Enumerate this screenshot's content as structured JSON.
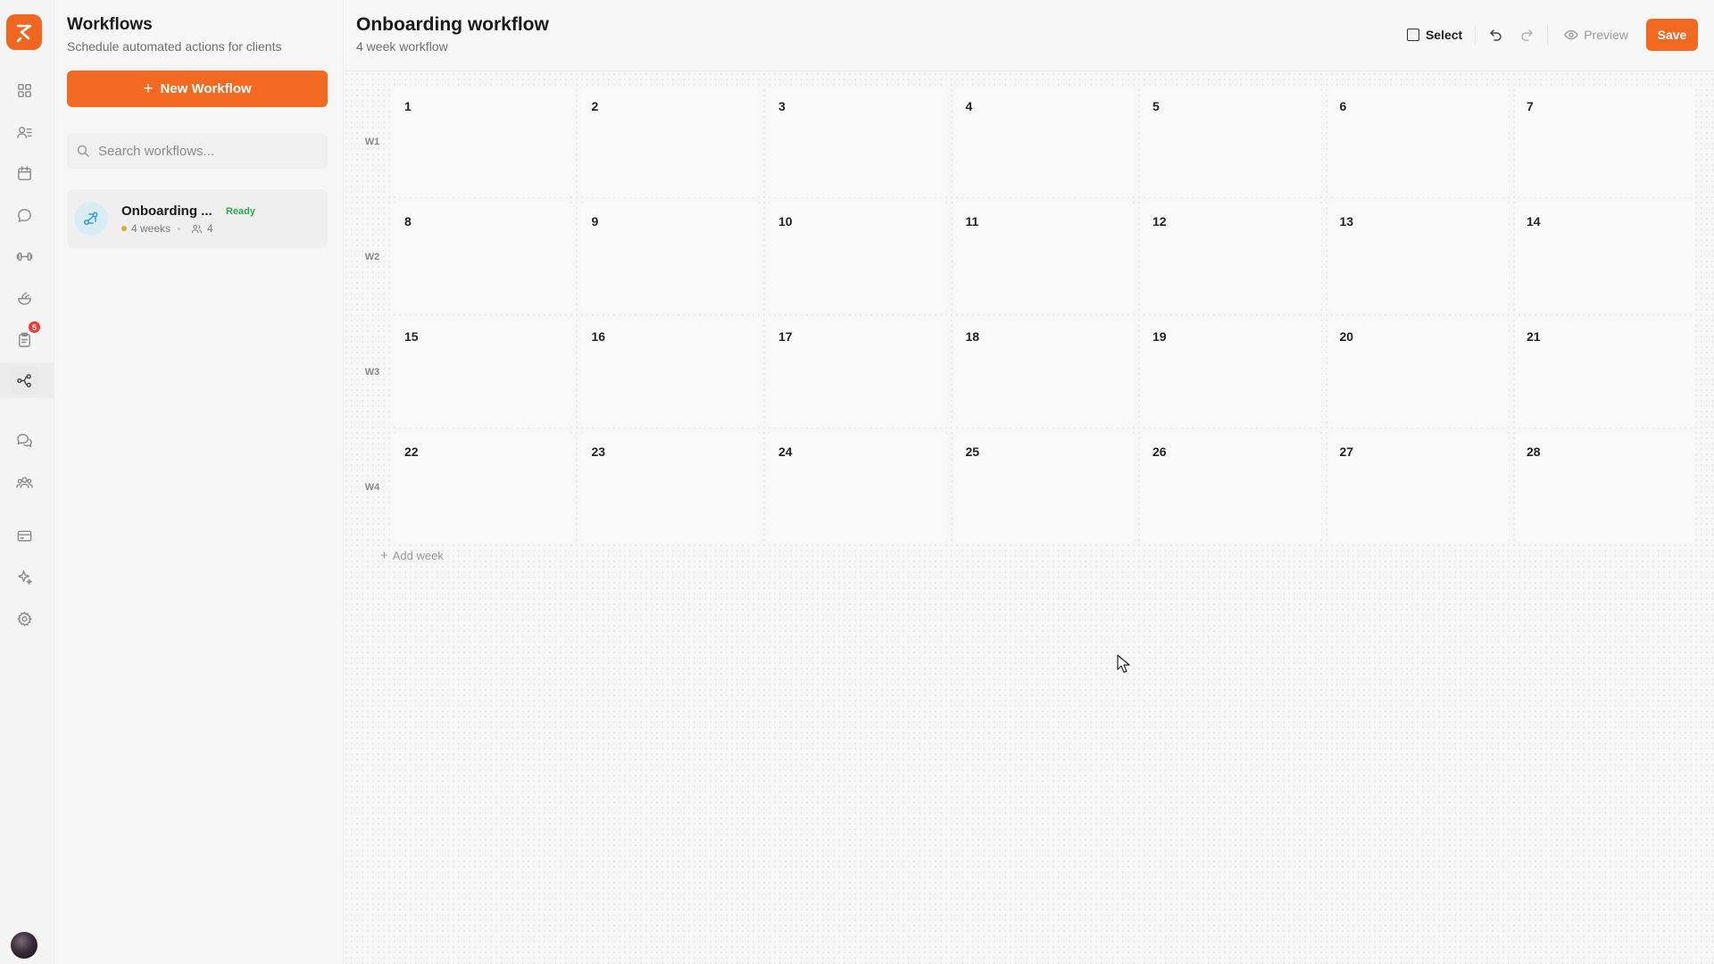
{
  "rail": {
    "items": [
      {
        "name": "dashboard",
        "icon": "grid-icon"
      },
      {
        "name": "clients",
        "icon": "users-list-icon"
      },
      {
        "name": "calendar",
        "icon": "calendar-icon"
      },
      {
        "name": "messages",
        "icon": "chat-bubble-icon"
      },
      {
        "name": "workouts",
        "icon": "dumbbell-icon"
      },
      {
        "name": "nutrition",
        "icon": "food-bowl-icon"
      },
      {
        "name": "tasks",
        "icon": "clipboard-icon",
        "badge": "5"
      },
      {
        "name": "workflows",
        "icon": "workflow-icon",
        "active": true
      },
      {
        "name": "community",
        "icon": "chat-bubbles-icon"
      },
      {
        "name": "team",
        "icon": "team-icon"
      },
      {
        "name": "billing",
        "icon": "credit-card-icon"
      },
      {
        "name": "ai",
        "icon": "sparkle-icon"
      },
      {
        "name": "settings",
        "icon": "gear-icon"
      }
    ]
  },
  "panel": {
    "title": "Workflows",
    "subtitle": "Schedule automated actions for clients",
    "new_button": "New Workflow",
    "search_placeholder": "Search workflows...",
    "workflows": [
      {
        "name": "Onboarding ...",
        "status": "Ready",
        "weeks": "4 weeks",
        "clients": "4"
      }
    ]
  },
  "main": {
    "title": "Onboarding workflow",
    "subtitle": "4 week workflow",
    "toolbar": {
      "select": "Select",
      "preview": "Preview",
      "save": "Save"
    },
    "weeks": [
      {
        "label": "W1",
        "days": [
          "1",
          "2",
          "3",
          "4",
          "5",
          "6",
          "7"
        ]
      },
      {
        "label": "W2",
        "days": [
          "8",
          "9",
          "10",
          "11",
          "12",
          "13",
          "14"
        ]
      },
      {
        "label": "W3",
        "days": [
          "15",
          "16",
          "17",
          "18",
          "19",
          "20",
          "21"
        ]
      },
      {
        "label": "W4",
        "days": [
          "22",
          "23",
          "24",
          "25",
          "26",
          "27",
          "28"
        ]
      }
    ],
    "add_week": "Add week"
  },
  "colors": {
    "accent": "#f26a21",
    "status_ready": "#2fa84f",
    "badge": "#ee3b3b"
  }
}
